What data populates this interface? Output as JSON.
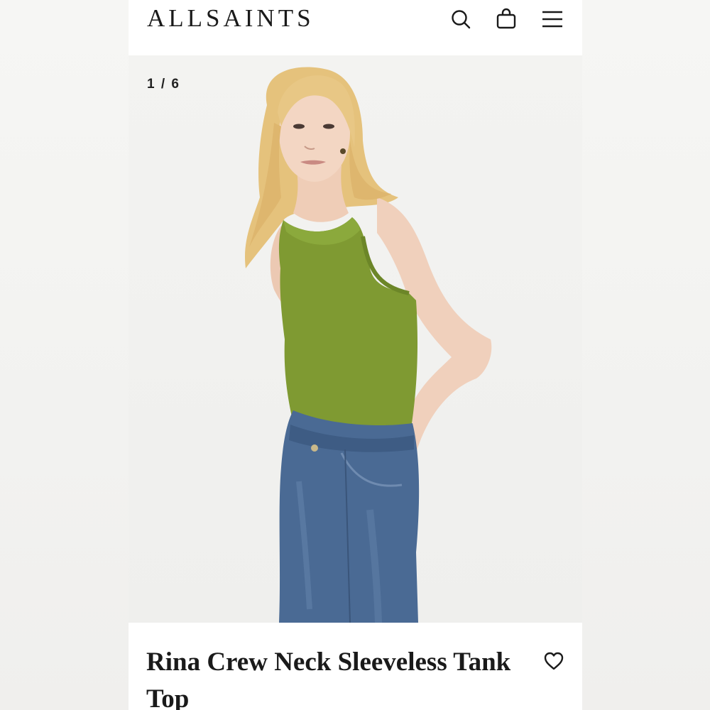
{
  "header": {
    "logo": "ALLSAINTS",
    "icons": [
      "search-icon",
      "bag-icon",
      "menu-icon"
    ]
  },
  "gallery": {
    "counter": "1 / 6",
    "image_alt": "Model wearing green sleeveless tank top with blue jeans"
  },
  "product": {
    "title": "Rina Crew Neck Sleeveless Tank Top",
    "wishlist_icon": "heart-icon"
  },
  "colors": {
    "text": "#1a1a1a",
    "tank_green": "#7f9a32",
    "denim": "#4a6a94",
    "background": "#f3f3f1"
  }
}
